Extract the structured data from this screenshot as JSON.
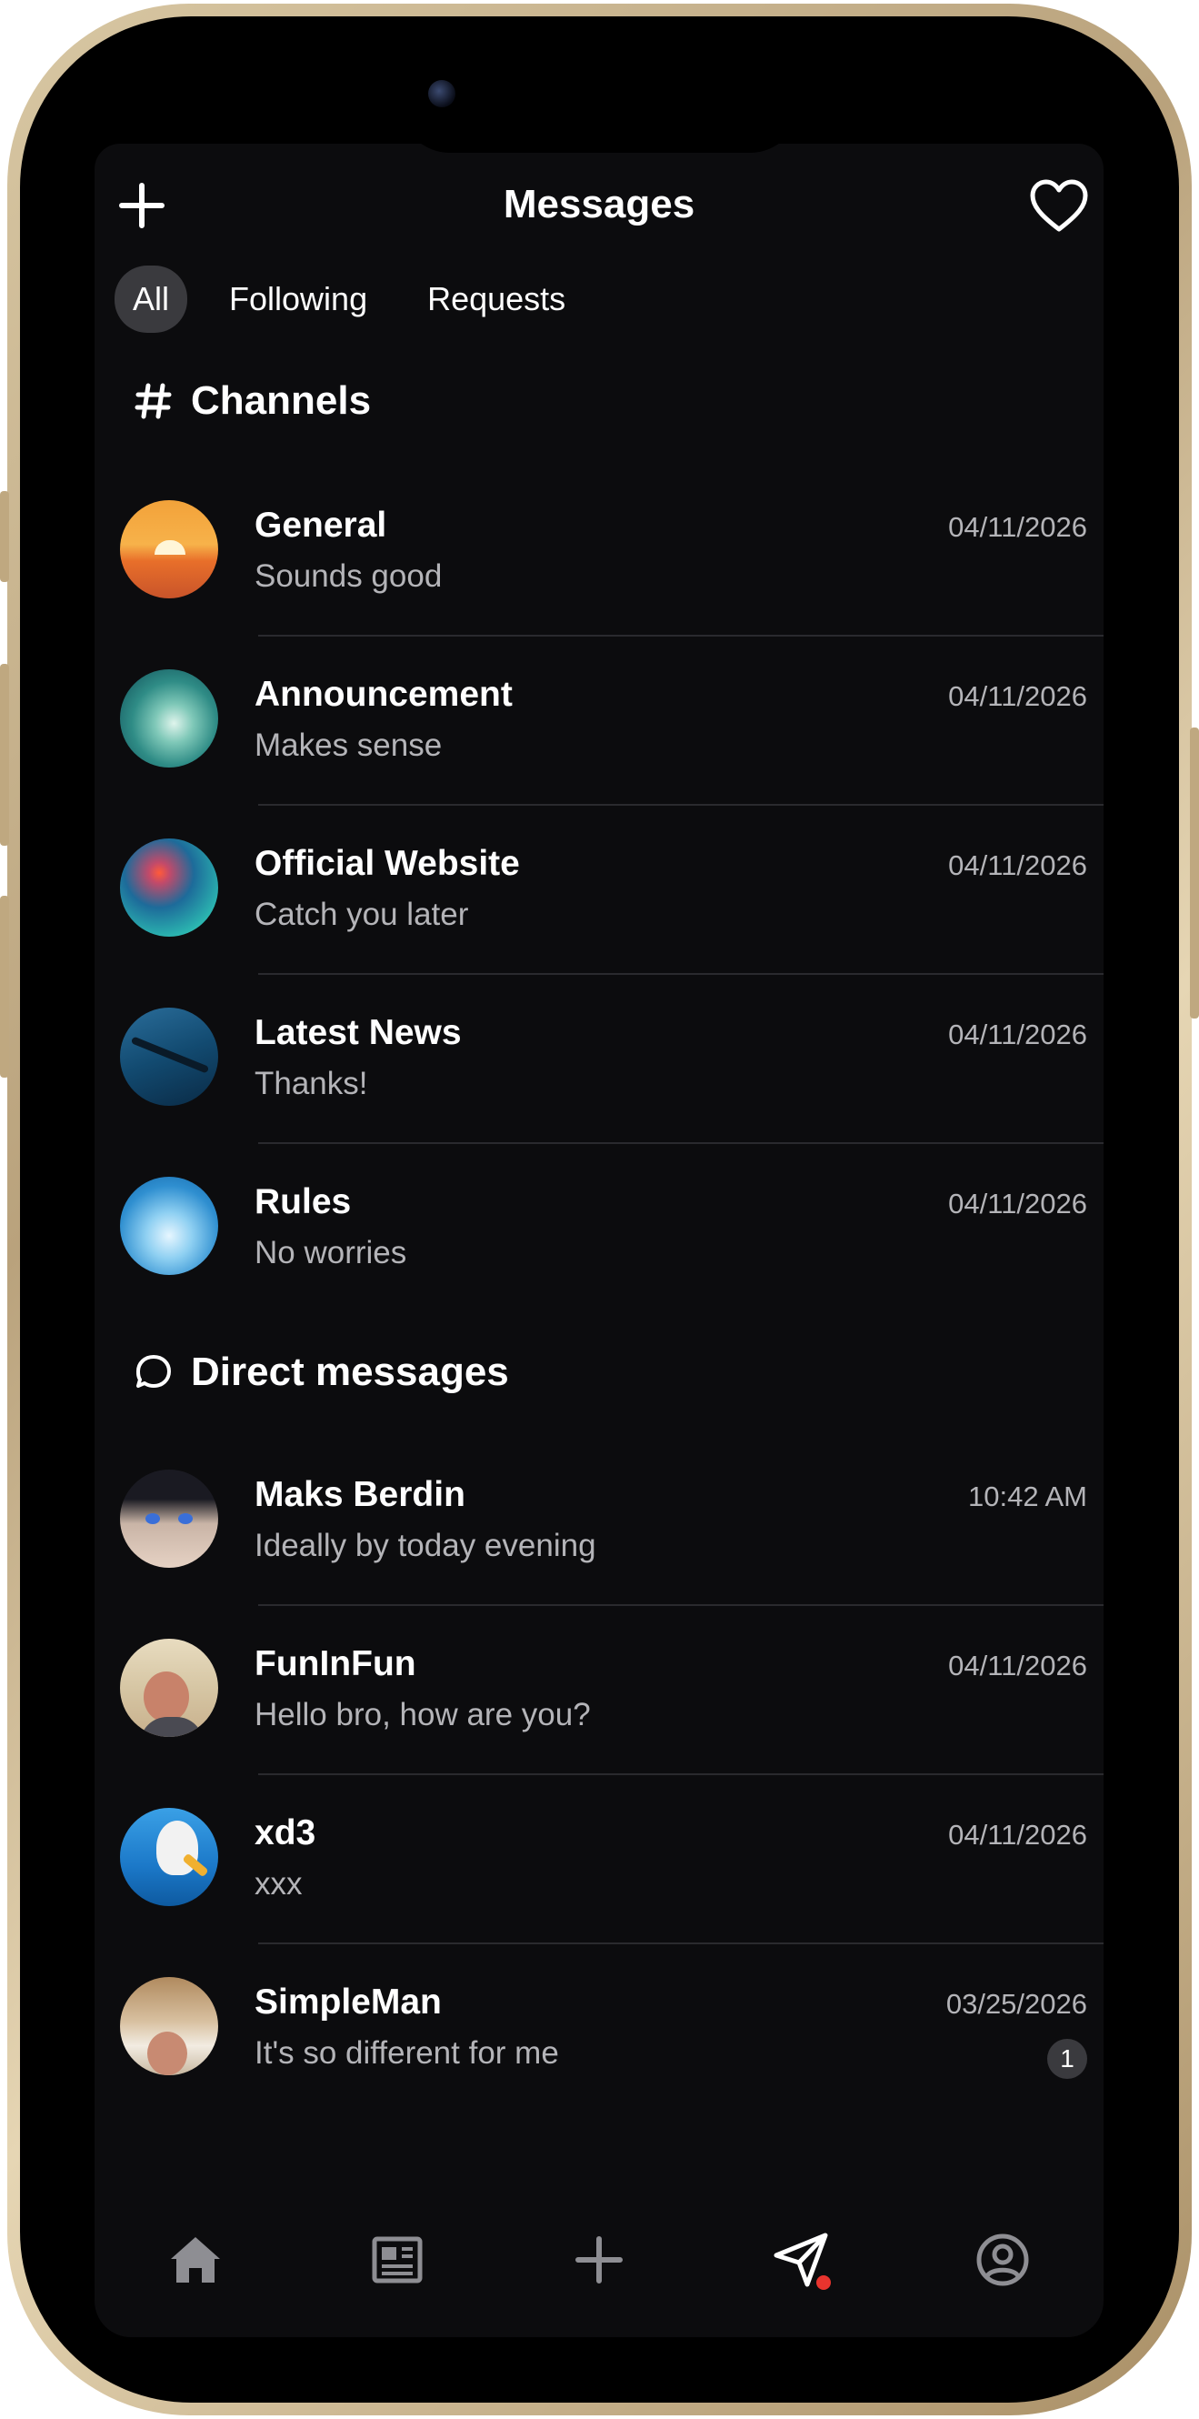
{
  "header": {
    "title": "Messages",
    "add_icon": "plus-icon",
    "activity_icon": "heart-icon"
  },
  "tabs": [
    {
      "label": "All",
      "active": true
    },
    {
      "label": "Following",
      "active": false
    },
    {
      "label": "Requests",
      "active": false
    }
  ],
  "channels": {
    "heading": "Channels",
    "icon": "hash-icon",
    "items": [
      {
        "name": "General",
        "message": "Sounds good",
        "time": "04/11/2026",
        "avatar": "sunset"
      },
      {
        "name": "Announcement",
        "message": "Makes sense",
        "time": "04/11/2026",
        "avatar": "wave"
      },
      {
        "name": "Official Website",
        "message": "Catch you later",
        "time": "04/11/2026",
        "avatar": "jellyfish"
      },
      {
        "name": "Latest News",
        "message": "Thanks!",
        "time": "04/11/2026",
        "avatar": "diver"
      },
      {
        "name": "Rules",
        "message": "No worries",
        "time": "04/11/2026",
        "avatar": "fish"
      }
    ]
  },
  "direct_messages": {
    "heading": "Direct messages",
    "icon": "chat-bubble-icon",
    "items": [
      {
        "name": "Maks Berdin",
        "message": "Ideally by today evening",
        "time": "10:42 AM",
        "avatar": "anime"
      },
      {
        "name": "FunInFun",
        "message": "Hello bro, how are you?",
        "time": "04/11/2026",
        "avatar": "man-wave"
      },
      {
        "name": "xd3",
        "message": "xxx",
        "time": "04/11/2026",
        "avatar": "seagull"
      },
      {
        "name": "SimpleMan",
        "message": "It's so different for me",
        "time": "03/25/2026",
        "unread": "1",
        "avatar": "man-room"
      }
    ]
  },
  "bottom_nav": [
    {
      "icon": "home-icon",
      "active": false
    },
    {
      "icon": "news-icon",
      "active": false
    },
    {
      "icon": "plus-icon",
      "active": false
    },
    {
      "icon": "send-icon",
      "active": true,
      "has_notification": true
    },
    {
      "icon": "profile-icon",
      "active": false
    }
  ],
  "colors": {
    "background": "#0c0c0e",
    "text_primary": "#ffffff",
    "text_secondary": "#b4b4b8",
    "tab_active": "#3a3a3e",
    "notification_dot": "#e8342e",
    "frame_gold": "#c9b48c"
  }
}
